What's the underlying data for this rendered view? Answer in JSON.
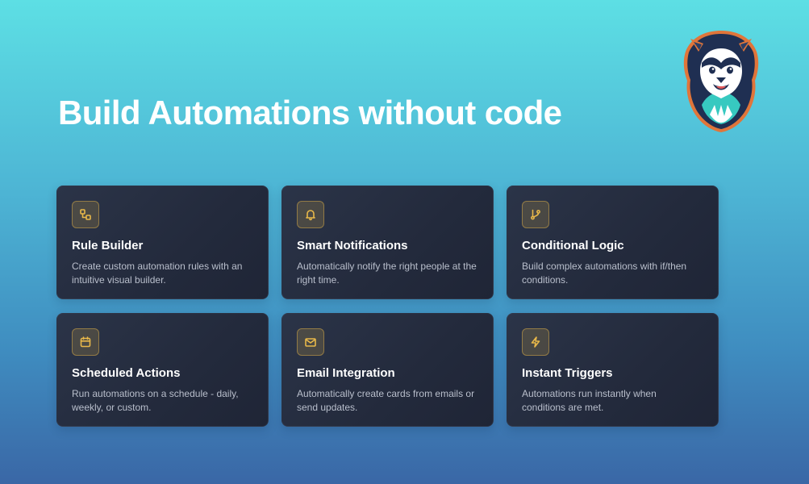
{
  "hero": {
    "title": "Build Automations without code"
  },
  "mascot": {
    "icon": "lion-mascot-icon"
  },
  "colors": {
    "background_top": "#5ddfe4",
    "background_bottom": "#3a67a6",
    "card_background": "#262e41",
    "icon_accent": "#e8b84a"
  },
  "features": [
    {
      "icon": "flow-blocks-icon",
      "title": "Rule Builder",
      "description": "Create custom automation rules with an intuitive visual builder."
    },
    {
      "icon": "bell-icon",
      "title": "Smart Notifications",
      "description": "Automatically notify the right people at the right time."
    },
    {
      "icon": "git-branch-icon",
      "title": "Conditional Logic",
      "description": "Build complex automations with if/then conditions."
    },
    {
      "icon": "calendar-icon",
      "title": "Scheduled Actions",
      "description": "Run automations on a schedule - daily, weekly, or custom."
    },
    {
      "icon": "mail-icon",
      "title": "Email Integration",
      "description": "Automatically create cards from emails or send updates."
    },
    {
      "icon": "lightning-icon",
      "title": "Instant Triggers",
      "description": "Automations run instantly when conditions are met."
    }
  ]
}
